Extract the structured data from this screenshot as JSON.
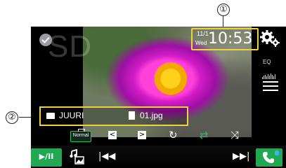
{
  "callouts": [
    "①",
    "②"
  ],
  "status": {
    "date_month": "11/1",
    "date_day": "Wed",
    "time": "10:53"
  },
  "source_label": "SD",
  "side_panel": {
    "eq_label": "EQ"
  },
  "file_info": {
    "folder_name": "JUURI",
    "file_name": "01.jpg"
  },
  "playback_modes": {
    "normal_label": "Normal",
    "prev_folder_glyph": "<",
    "next_folder_glyph": ">",
    "rotate_glyph": "↻",
    "repeat_glyph": "⇄",
    "shuffle_glyph": "⤨"
  },
  "bottom_bar": {
    "play_pause_label": "▶/II",
    "prev_glyph": "|◀◀",
    "next_glyph": "▶▶|"
  },
  "colors": {
    "highlight": "#f0d23a",
    "accent_green": "#22a853",
    "bluetooth_blue": "#3ab0ff"
  },
  "icons": [
    "check-icon",
    "gear-icon",
    "list-icon",
    "folder-icon",
    "file-icon",
    "music-photo-icon",
    "phone-icon",
    "bluetooth-icon"
  ]
}
